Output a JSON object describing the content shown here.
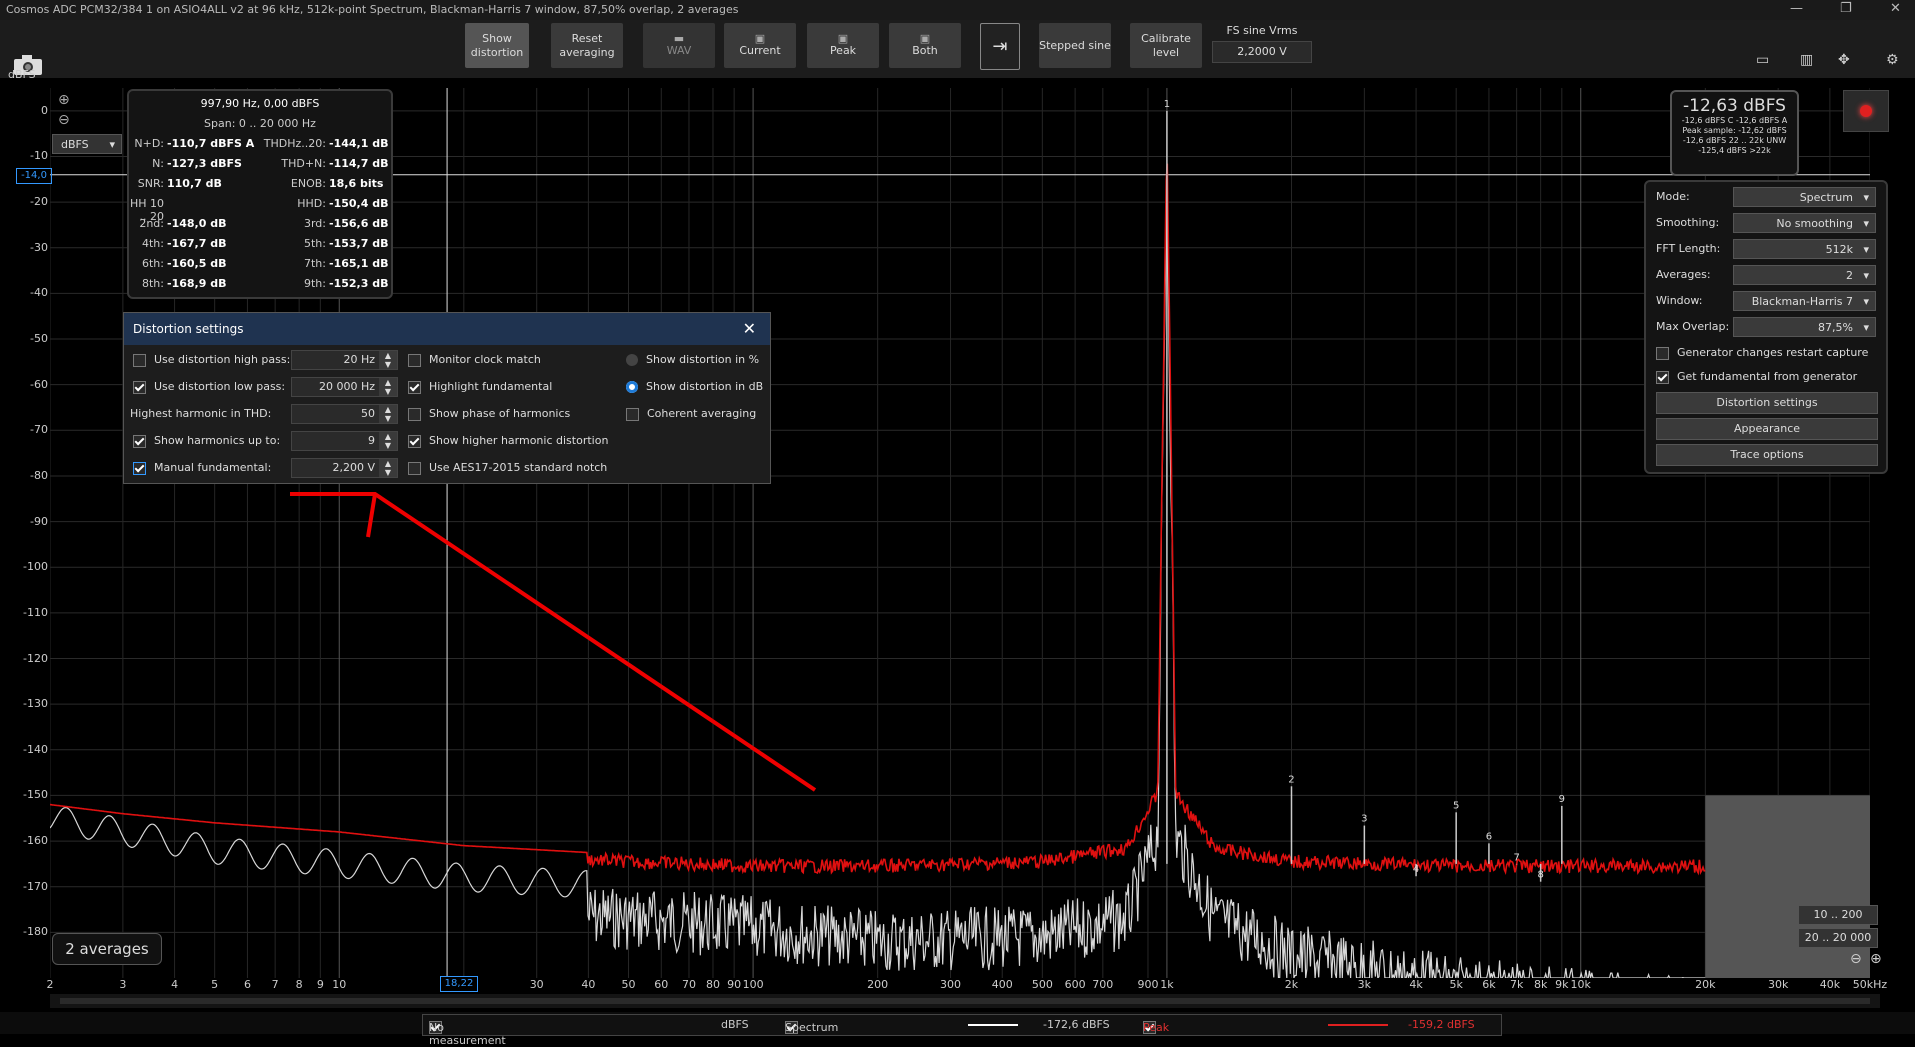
{
  "window": {
    "title": "Cosmos ADC PCM32/384 1 on ASIO4ALL v2 at 96 kHz, 512k-point Spectrum, Blackman-Harris 7 window, 87,50% overlap, 2 averages"
  },
  "toolbar": {
    "show_distortion": "Show distortion",
    "reset_averaging": "Reset averaging",
    "wav": "WAV",
    "current": "Current",
    "peak": "Peak",
    "both": "Both",
    "stepped_sine": "Stepped sine",
    "calibrate_level": "Calibrate level",
    "fs_label": "FS sine Vrms",
    "fs_value": "2,2000 V"
  },
  "yaxis": {
    "unit": "dBFS",
    "unit_select": "dBFS",
    "cursor": "-14,0",
    "ticks": [
      "0",
      "-10",
      "-20",
      "-30",
      "-40",
      "-50",
      "-60",
      "-70",
      "-80",
      "-90",
      "-100",
      "-110",
      "-120",
      "-130",
      "-140",
      "-150",
      "-160",
      "-170",
      "-180"
    ]
  },
  "xaxis": {
    "ticks": [
      [
        "2",
        2
      ],
      [
        "3",
        3
      ],
      [
        "4",
        4
      ],
      [
        "5",
        5
      ],
      [
        "6",
        6
      ],
      [
        "7",
        7
      ],
      [
        "8",
        8
      ],
      [
        "9",
        9
      ],
      [
        "10",
        10
      ],
      [
        "20",
        20
      ],
      [
        "30",
        30
      ],
      [
        "40",
        40
      ],
      [
        "50",
        50
      ],
      [
        "60",
        60
      ],
      [
        "70",
        70
      ],
      [
        "80",
        80
      ],
      [
        "90",
        90
      ],
      [
        "100",
        100
      ],
      [
        "200",
        200
      ],
      [
        "300",
        300
      ],
      [
        "400",
        400
      ],
      [
        "500",
        500
      ],
      [
        "600",
        600
      ],
      [
        "700",
        700
      ],
      [
        "900",
        900
      ],
      [
        "1k",
        1000
      ],
      [
        "2k",
        2000
      ],
      [
        "3k",
        3000
      ],
      [
        "4k",
        4000
      ],
      [
        "5k",
        5000
      ],
      [
        "6k",
        6000
      ],
      [
        "7k",
        7000
      ],
      [
        "8k",
        8000
      ],
      [
        "9k",
        9000
      ],
      [
        "10k",
        10000
      ],
      [
        "20k",
        20000
      ],
      [
        "30k",
        30000
      ],
      [
        "40k",
        40000
      ],
      [
        "50kHz",
        50000
      ]
    ],
    "cursor": "18,22"
  },
  "readout": {
    "header": "997,90 Hz, 0,00 dBFS",
    "span": "Span: 0 .. 20 000 Hz",
    "rows": [
      [
        "N+D:",
        "-110,7 dBFS A",
        "THD",
        "Hz..20:",
        "-144,1 dB"
      ],
      [
        "N:",
        "-127,3 dBFS",
        "THD+N:",
        "",
        "-114,7 dB"
      ],
      [
        "SNR:",
        "110,7 dB",
        "ENOB:",
        "",
        "18,6 bits"
      ],
      [
        "HH 10 .. 20",
        "",
        "HHD:",
        "",
        "-150,4 dB"
      ],
      [
        "2nd:",
        "-148,0 dB",
        "3rd:",
        "",
        "-156,6 dB"
      ],
      [
        "4th:",
        "-167,7 dB",
        "5th:",
        "",
        "-153,7 dB"
      ],
      [
        "6th:",
        "-160,5 dB",
        "7th:",
        "",
        "-165,1 dB"
      ],
      [
        "8th:",
        "-168,9 dB",
        "9th:",
        "",
        "-152,3 dB"
      ]
    ]
  },
  "dialog": {
    "title": "Distortion settings",
    "hp_label": "Use distortion high pass:",
    "hp_value": "20 Hz",
    "lp_label": "Use distortion low pass:",
    "lp_value": "20 000 Hz",
    "hh_label": "Highest harmonic in THD:",
    "hh_value": "50",
    "sh_label": "Show harmonics up to:",
    "sh_value": "9",
    "mf_label": "Manual fundamental:",
    "mf_value": "2,200 V",
    "monitor": "Monitor clock match",
    "highlight": "Highlight fundamental",
    "phase": "Show phase of harmonics",
    "higher": "Show higher harmonic distortion",
    "aes": "Use AES17-2015 standard notch",
    "pct": "Show distortion in %",
    "db": "Show distortion in dB",
    "coherent": "Coherent averaging"
  },
  "peak_box": {
    "big": "-12,63 dBFS",
    "l1": "-12,6 dBFS C  -12,6 dBFS A",
    "l2": "Peak sample: -12,62 dBFS",
    "l3": "-12,6 dBFS 22 .. 22k UNW",
    "l4": "-125,4 dBFS >22k"
  },
  "settings": {
    "mode_label": "Mode:",
    "mode": "Spectrum",
    "smooth_label": "Smoothing:",
    "smooth": "No smoothing",
    "fft_label": "FFT Length:",
    "fft": "512k",
    "avg_label": "Averages:",
    "avg": "2",
    "win_label": "Window:",
    "win": "Blackman-Harris 7",
    "ovl_label": "Max Overlap:",
    "ovl": "87,5%",
    "gen_restart": "Generator changes restart capture",
    "fund_gen": "Get fundamental from generator",
    "dist_btn": "Distortion settings",
    "app_btn": "Appearance",
    "trace_btn": "Trace options"
  },
  "averages_badge": "2 averages",
  "zoom": {
    "a": "10 .. 200",
    "b": "20 .. 20 000"
  },
  "status": {
    "nomeas": "No measurement",
    "unit": "dBFS",
    "spectrum": "Spectrum",
    "spec_val": "-172,6 dBFS",
    "peak": "Peak",
    "peak_val": "-159,2 dBFS"
  },
  "chart_data": {
    "type": "line",
    "xlabel": "",
    "ylabel": "dBFS",
    "xlim": [
      2,
      50000
    ],
    "ylim": [
      -190,
      5
    ],
    "xscale": "log",
    "harmonics": [
      {
        "n": "1",
        "f": 1000,
        "db": 0
      },
      {
        "n": "2",
        "f": 2000,
        "db": -148
      },
      {
        "n": "3",
        "f": 3000,
        "db": -156.6
      },
      {
        "n": "4",
        "f": 4000,
        "db": -167.7
      },
      {
        "n": "5",
        "f": 5000,
        "db": -153.7
      },
      {
        "n": "6",
        "f": 6000,
        "db": -160.5
      },
      {
        "n": "7",
        "f": 7000,
        "db": -165.1
      },
      {
        "n": "8",
        "f": 8000,
        "db": -168.9
      },
      {
        "n": "9",
        "f": 9000,
        "db": -152.3
      }
    ],
    "series": [
      {
        "name": "Peak",
        "color": "#e01010",
        "x": [
          2,
          3,
          5,
          10,
          20,
          50,
          100,
          200,
          500,
          800,
          950,
          1000,
          1050,
          1300,
          2000,
          5000,
          10000,
          20000
        ],
        "y": [
          -152,
          -154,
          -156,
          -158,
          -161,
          -163,
          -164,
          -164,
          -163,
          -160,
          -148,
          -2,
          -148,
          -160,
          -163,
          -164,
          -164,
          -164
        ]
      },
      {
        "name": "Spectrum",
        "color": "#d8d8d8",
        "x": [
          2,
          3,
          5,
          10,
          20,
          50,
          100,
          200,
          500,
          800,
          950,
          1000,
          1050,
          1300,
          2000,
          5000,
          10000,
          20000
        ],
        "y": [
          -155,
          -158,
          -162,
          -165,
          -168,
          -170,
          -172,
          -175,
          -174,
          -170,
          -152,
          -4,
          -152,
          -170,
          -178,
          -185,
          -188,
          -190
        ]
      }
    ]
  }
}
